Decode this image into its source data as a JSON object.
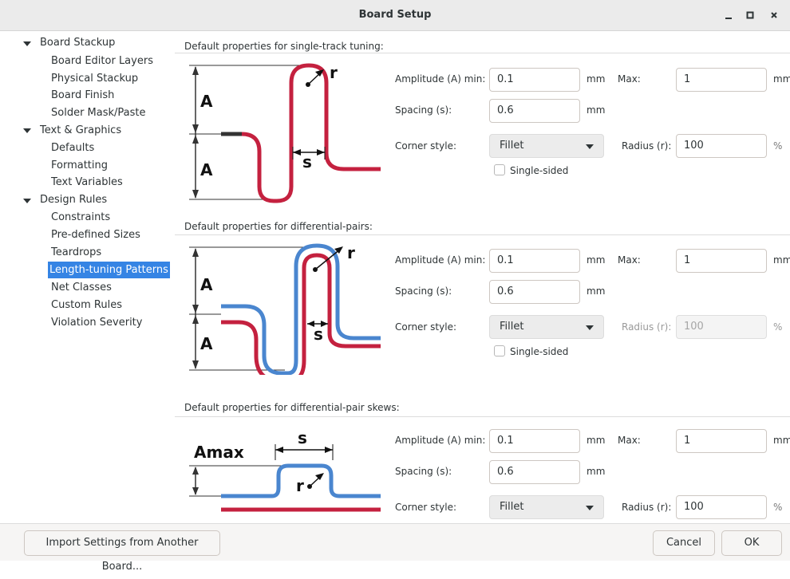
{
  "window": {
    "title": "Board Setup",
    "controls": [
      "minimize-icon",
      "maximize-icon",
      "close-icon"
    ]
  },
  "sidebar": {
    "items": [
      {
        "label": "Board Stackup",
        "level": 0,
        "expanded": true
      },
      {
        "label": "Board Editor Layers",
        "level": 1
      },
      {
        "label": "Physical Stackup",
        "level": 1
      },
      {
        "label": "Board Finish",
        "level": 1
      },
      {
        "label": "Solder Mask/Paste",
        "level": 1
      },
      {
        "label": "Text & Graphics",
        "level": 0,
        "expanded": true
      },
      {
        "label": "Defaults",
        "level": 1
      },
      {
        "label": "Formatting",
        "level": 1
      },
      {
        "label": "Text Variables",
        "level": 1
      },
      {
        "label": "Design Rules",
        "level": 0,
        "expanded": true
      },
      {
        "label": "Constraints",
        "level": 1
      },
      {
        "label": "Pre-defined Sizes",
        "level": 1
      },
      {
        "label": "Teardrops",
        "level": 1
      },
      {
        "label": "Length-tuning Patterns",
        "level": 1,
        "selected": true
      },
      {
        "label": "Net Classes",
        "level": 1
      },
      {
        "label": "Custom Rules",
        "level": 1
      },
      {
        "label": "Violation Severity",
        "level": 1
      }
    ]
  },
  "labels": {
    "amplitude_min": "Amplitude (A) min:",
    "max": "Max:",
    "spacing": "Spacing (s):",
    "corner_style": "Corner style:",
    "radius": "Radius (r):",
    "mm": "mm",
    "percent": "%",
    "single_sided": "Single-sided"
  },
  "sections": {
    "single": {
      "title": "Default properties for single-track tuning:",
      "amp_min": "0.1",
      "amp_max": "1",
      "spacing": "0.6",
      "corner_style": "Fillet",
      "radius": "100",
      "radius_enabled": true,
      "single_sided": false,
      "diagram_labels": {
        "A1": "A",
        "A2": "A",
        "s": "s",
        "r": "r"
      }
    },
    "diff": {
      "title": "Default properties for differential-pairs:",
      "amp_min": "0.1",
      "amp_max": "1",
      "spacing": "0.6",
      "corner_style": "Fillet",
      "radius": "100",
      "radius_enabled": false,
      "single_sided": false,
      "diagram_labels": {
        "A1": "A",
        "A2": "A",
        "s": "s",
        "r": "r"
      }
    },
    "skew": {
      "title": "Default properties for differential-pair skews:",
      "amp_min": "0.1",
      "amp_max": "1",
      "spacing": "0.6",
      "corner_style": "Fillet",
      "radius": "100",
      "radius_enabled": true,
      "diagram_labels": {
        "Amax": "Amax",
        "s": "s",
        "r": "r"
      }
    }
  },
  "footer": {
    "import_button": "Import Settings from Another Board...",
    "cancel_button": "Cancel",
    "ok_button": "OK"
  },
  "colors": {
    "track_red": "#c4213f",
    "track_blue": "#4a86cf",
    "selection": "#3584e4"
  }
}
